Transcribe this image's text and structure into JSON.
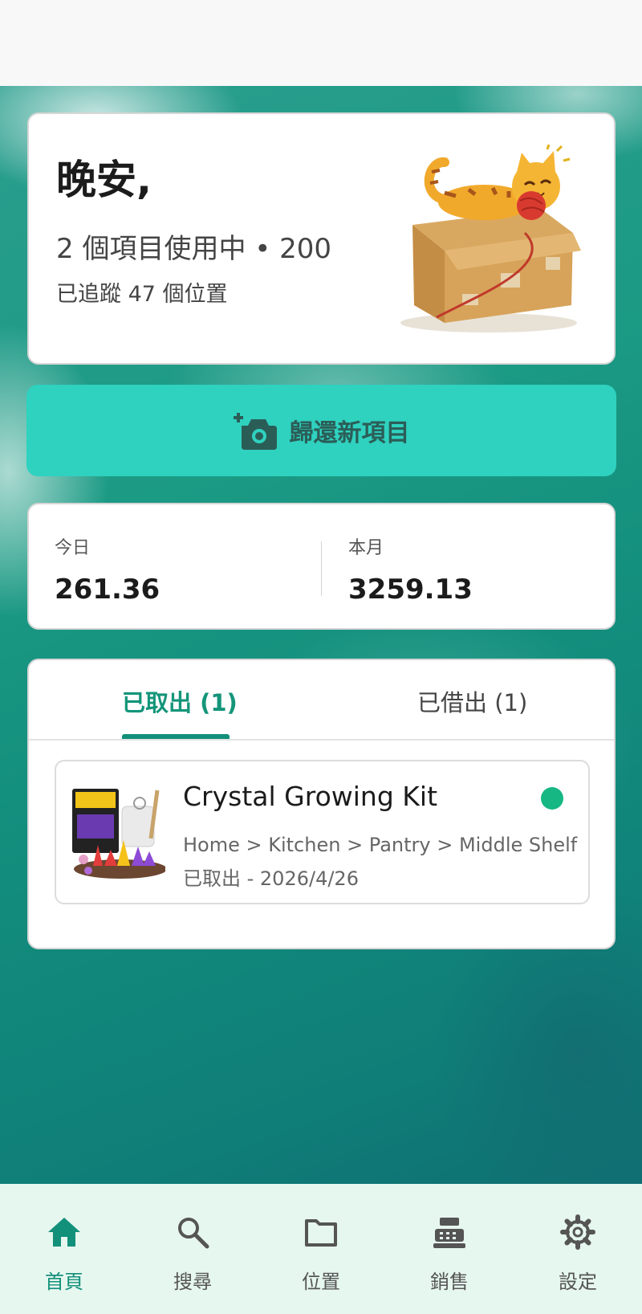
{
  "greeting": {
    "title": "晚安,",
    "stats": "2 個項目使用中 • 200",
    "locations": "已追蹤 47 個位置"
  },
  "actions": {
    "return_label": "歸還新項目"
  },
  "summary": {
    "today_label": "今日",
    "today_value": "261.36",
    "month_label": "本月",
    "month_value": "3259.13"
  },
  "tabs": [
    {
      "label": "已取出 (1)",
      "active": true
    },
    {
      "label": "已借出 (1)",
      "active": false
    }
  ],
  "items": [
    {
      "name": "Crystal Growing Kit",
      "path": "Home > Kitchen > Pantry > Middle Shelf",
      "status": "已取出 - 2026/4/26",
      "status_color": "#17b783"
    }
  ],
  "nav": [
    {
      "label": "首頁",
      "icon": "home-icon",
      "active": true
    },
    {
      "label": "搜尋",
      "icon": "search-icon",
      "active": false
    },
    {
      "label": "位置",
      "icon": "folder-icon",
      "active": false
    },
    {
      "label": "銷售",
      "icon": "cash-register-icon",
      "active": false
    },
    {
      "label": "設定",
      "icon": "gear-icon",
      "active": false
    }
  ],
  "colors": {
    "accent": "#13907a",
    "button": "#2fd1bf",
    "nav_background": "#e6f7ef"
  }
}
